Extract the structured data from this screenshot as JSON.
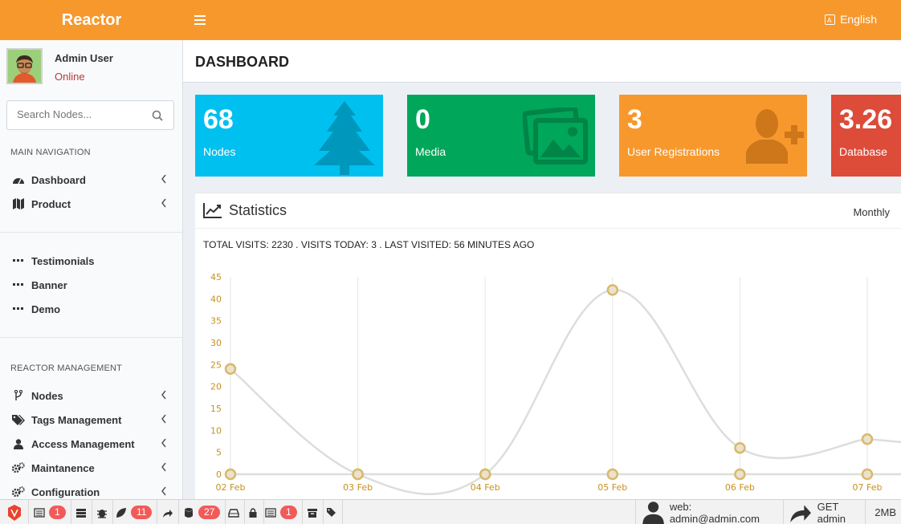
{
  "header": {
    "brand": "Reactor",
    "language": "English"
  },
  "user": {
    "name": "Admin User",
    "status": "Online"
  },
  "search": {
    "placeholder": "Search Nodes..."
  },
  "sidebar": {
    "main_heading": "MAIN NAVIGATION",
    "main_items": [
      {
        "label": "Dashboard",
        "icon": "dashboard-icon"
      },
      {
        "label": "Product",
        "icon": "map-icon"
      }
    ],
    "page_items": [
      {
        "label": "Testimonials",
        "icon": "dots-icon"
      },
      {
        "label": "Banner",
        "icon": "dots-icon"
      },
      {
        "label": "Demo",
        "icon": "dots-icon"
      }
    ],
    "mgmt_heading": "REACTOR MANAGEMENT",
    "mgmt_items": [
      {
        "label": "Nodes",
        "icon": "fork-icon"
      },
      {
        "label": "Tags Management",
        "icon": "tags-icon"
      },
      {
        "label": "Access Management",
        "icon": "user-icon"
      },
      {
        "label": "Maintanence",
        "icon": "cogs-icon"
      },
      {
        "label": "Configuration",
        "icon": "cogs-icon"
      }
    ]
  },
  "page": {
    "title": "DASHBOARD"
  },
  "stats": [
    {
      "value": "68",
      "label": "Nodes",
      "color": "#00c0ef",
      "icon": "tree-icon"
    },
    {
      "value": "0",
      "label": "Media",
      "color": "#00a65a",
      "icon": "images-icon"
    },
    {
      "value": "3",
      "label": "User Registrations",
      "color": "#f7982d",
      "icon": "user-plus-icon"
    },
    {
      "value": "3.26",
      "label": "Database",
      "color": "#dd4b39",
      "icon": "database-icon"
    }
  ],
  "statistics": {
    "title": "Statistics",
    "period": "Monthly",
    "summary": "TOTAL VISITS: 2230 . VISITS TODAY: 3 . LAST VISITED: 56 MINUTES AGO"
  },
  "chart_data": {
    "type": "line",
    "categories": [
      "02 Feb",
      "03 Feb",
      "04 Feb",
      "05 Feb",
      "06 Feb",
      "07 Feb"
    ],
    "series": [
      {
        "values": [
          24,
          0,
          0,
          42,
          6,
          8
        ]
      },
      {
        "values": [
          0,
          0,
          0,
          0,
          0,
          0
        ]
      }
    ],
    "ylim": [
      0,
      45
    ],
    "yticks": [
      0,
      5,
      10,
      15,
      20,
      25,
      30,
      35,
      40,
      45
    ],
    "grid": "vertical",
    "colors": {
      "line": "#dddddd",
      "point": "#d9b96a",
      "tick": "#c8901e"
    }
  },
  "bottombar": {
    "badges": [
      "1",
      "11",
      "27",
      "1"
    ],
    "user": "web: admin@admin.com",
    "request": "GET admin",
    "memory": "2MB"
  }
}
